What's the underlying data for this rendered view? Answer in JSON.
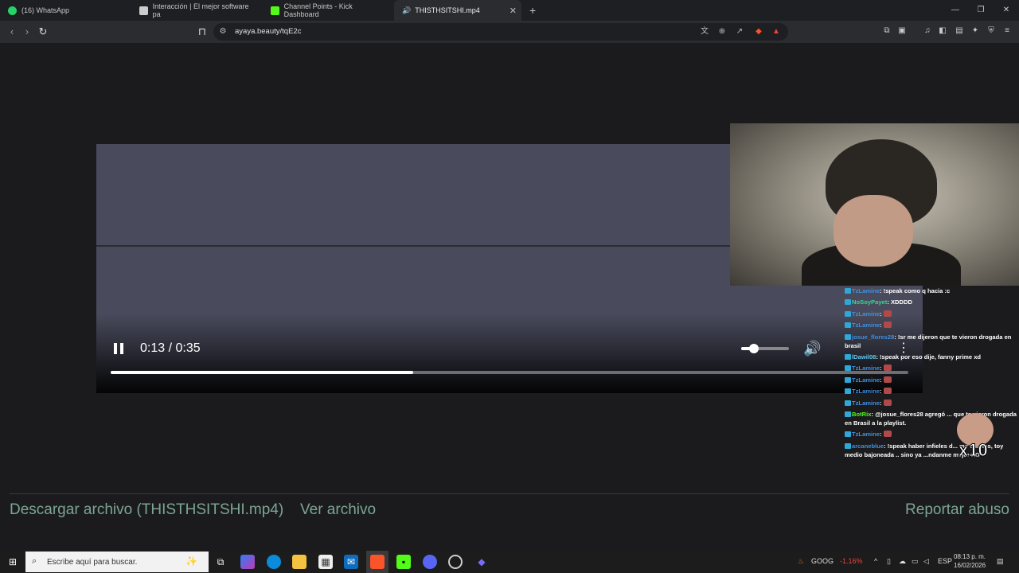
{
  "browser": {
    "tabs": [
      {
        "label": "(16) WhatsApp",
        "icon": "whatsapp-icon",
        "color": "#25d366"
      },
      {
        "label": "Interacción | El mejor software pa",
        "icon": "app-icon",
        "color": "#cccccc"
      },
      {
        "label": "Channel Points - Kick Dashboard",
        "icon": "kick-icon",
        "color": "#53fc18"
      },
      {
        "label": "THISTHSITSHI.mp4",
        "icon": "speaker-icon",
        "color": "#cccccc",
        "active": true
      }
    ],
    "url": "ayaya.beauty/tqE2c",
    "notification_count": "1"
  },
  "player": {
    "current_time": "0:13",
    "duration": "0:35",
    "time_display": "0:13 / 0:35",
    "progress_fraction": 0.379,
    "volume_fraction": 0.3,
    "state": "playing"
  },
  "chat": {
    "messages": [
      {
        "user": "TzLamine",
        "text": ": !speak como q hacia :c",
        "user_color": "#3f8fe0"
      },
      {
        "user": "NoSoyPayet",
        "text": ": XDDDD",
        "user_color": "#39d39b"
      },
      {
        "user": "TzLamine",
        "text": ": ",
        "emote": true,
        "user_color": "#3f8fe0"
      },
      {
        "user": "TzLamine",
        "text": ": ",
        "emote": true,
        "user_color": "#3f8fe0"
      },
      {
        "user": "josue_flores28",
        "text": ": !sr me dijeron que te vieron drogada en brasil",
        "user_color": "#3f8fe0"
      },
      {
        "user": "lDawil08",
        "text": ": !speak por eso dije, fanny prime xd",
        "user_color": "#5ec8f0"
      },
      {
        "user": "TzLamine",
        "text": ": ",
        "emote": true,
        "user_color": "#3f8fe0"
      },
      {
        "user": "TzLamine",
        "text": ": ",
        "emote": true,
        "user_color": "#3f8fe0"
      },
      {
        "user": "TzLamine",
        "text": ": ",
        "emote": true,
        "user_color": "#3f8fe0"
      },
      {
        "user": "TzLamine",
        "text": ": ",
        "emote": true,
        "user_color": "#3f8fe0"
      },
      {
        "user": "BotRix",
        "text": ": @josue_flores28 agregó ... que te vieron drogada en Brasil a la playlist.",
        "user_color": "#53fc18"
      },
      {
        "user": "TzLamine",
        "text": ": ",
        "emote": true,
        "user_color": "#3f8fe0"
      },
      {
        "user": "arcaneblue",
        "text": ": !speak haber infieles d... me ánimos, toy medio bajoneada .. sino ya ...ndanme mejor XD",
        "user_color": "#3f8fe0"
      }
    ],
    "overlay_text": "x10"
  },
  "footer": {
    "download_link": "Descargar archivo (THISTHSITSHI.mp4)",
    "view_link": "Ver archivo",
    "report_link": "Reportar abuso"
  },
  "taskbar": {
    "search_placeholder": "Escribe aquí para buscar.",
    "stock_ticker": "GOOG",
    "stock_change": "-1.16%",
    "language": "ESP",
    "time": "08:13 p. m.",
    "date": "16/02/2026"
  }
}
